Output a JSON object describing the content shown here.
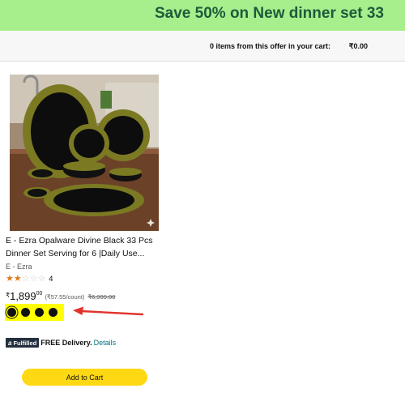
{
  "banner": {
    "text": "Save 50% on New dinner set 33"
  },
  "cart_summary": {
    "label": "0 items from this offer in your cart:",
    "value": "₹0.00"
  },
  "product": {
    "title": "E - Ezra Opalware Divine Black 33 Pcs Dinner Set Serving for 6 |Daily Use...",
    "brand": "E - Ezra",
    "rating": {
      "value": 2,
      "max": 5,
      "count": "4",
      "stars_full": "★★",
      "stars_empty": "☆☆☆"
    },
    "price": {
      "currency": "₹",
      "whole": "1,899",
      "fraction": "00",
      "unit_price": "(₹57.55/count)",
      "list_price": "₹6,999.00"
    },
    "swatches": [
      {
        "color": "#111111",
        "selected": true
      },
      {
        "color": "#111111",
        "selected": false
      },
      {
        "color": "#111111",
        "selected": false
      },
      {
        "color": "#111111",
        "selected": false
      }
    ],
    "delivery": {
      "badge_icon": "a",
      "badge_text": "Fulfilled",
      "free_delivery": "FREE Delivery.",
      "details_link": "Details"
    },
    "add_to_cart": "Add to Cart"
  },
  "colors": {
    "banner_bg": "#a6ef8c",
    "banner_text": "#1e5a3c",
    "highlight": "#ffff00",
    "arrow": "#e0332c",
    "button": "#ffd814",
    "link": "#007185",
    "star": "#de7921"
  },
  "icons": {
    "annotation": "red-arrow-icon",
    "image_corner": "sparkle-icon"
  }
}
